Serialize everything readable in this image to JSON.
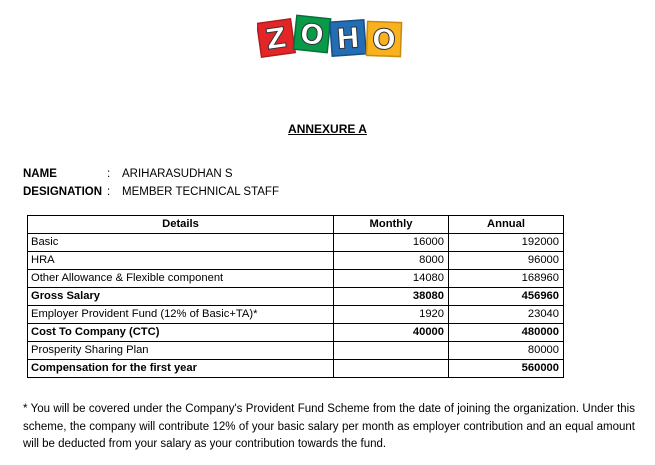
{
  "logo": {
    "text": "ZOHO",
    "letters": [
      "Z",
      "O",
      "H",
      "O"
    ],
    "colors": [
      "#e42527",
      "#089949",
      "#226db4",
      "#f9b21d"
    ]
  },
  "title": "ANNEXURE A",
  "employee": {
    "name_label": "NAME",
    "name_value": "ARIHARASUDHAN S",
    "designation_label": "DESIGNATION",
    "designation_value": "MEMBER TECHNICAL STAFF",
    "colon": ":"
  },
  "table": {
    "headers": [
      "Details",
      "Monthly",
      "Annual"
    ],
    "rows": [
      {
        "details": "Basic",
        "monthly": "16000",
        "annual": "192000",
        "bold": false
      },
      {
        "details": "HRA",
        "monthly": "8000",
        "annual": "96000",
        "bold": false
      },
      {
        "details": "Other Allowance & Flexible component",
        "monthly": "14080",
        "annual": "168960",
        "bold": false
      },
      {
        "details": "Gross Salary",
        "monthly": "38080",
        "annual": "456960",
        "bold": true
      },
      {
        "details": "Employer Provident Fund (12% of Basic+TA)*",
        "monthly": "1920",
        "annual": "23040",
        "bold": false
      },
      {
        "details": "Cost To Company (CTC)",
        "monthly": "40000",
        "annual": "480000",
        "bold": true
      },
      {
        "details": "Prosperity Sharing Plan",
        "monthly": "",
        "annual": "80000",
        "bold": false
      },
      {
        "details": "Compensation for the first year",
        "monthly": "",
        "annual": "560000",
        "bold": true
      }
    ]
  },
  "footnote": "* You will be covered under the Company's Provident Fund Scheme from the date of joining the organization. Under this scheme, the company will contribute 12% of your basic salary per month as employer contribution and an equal amount will be deducted from your salary as your contribution towards the fund."
}
